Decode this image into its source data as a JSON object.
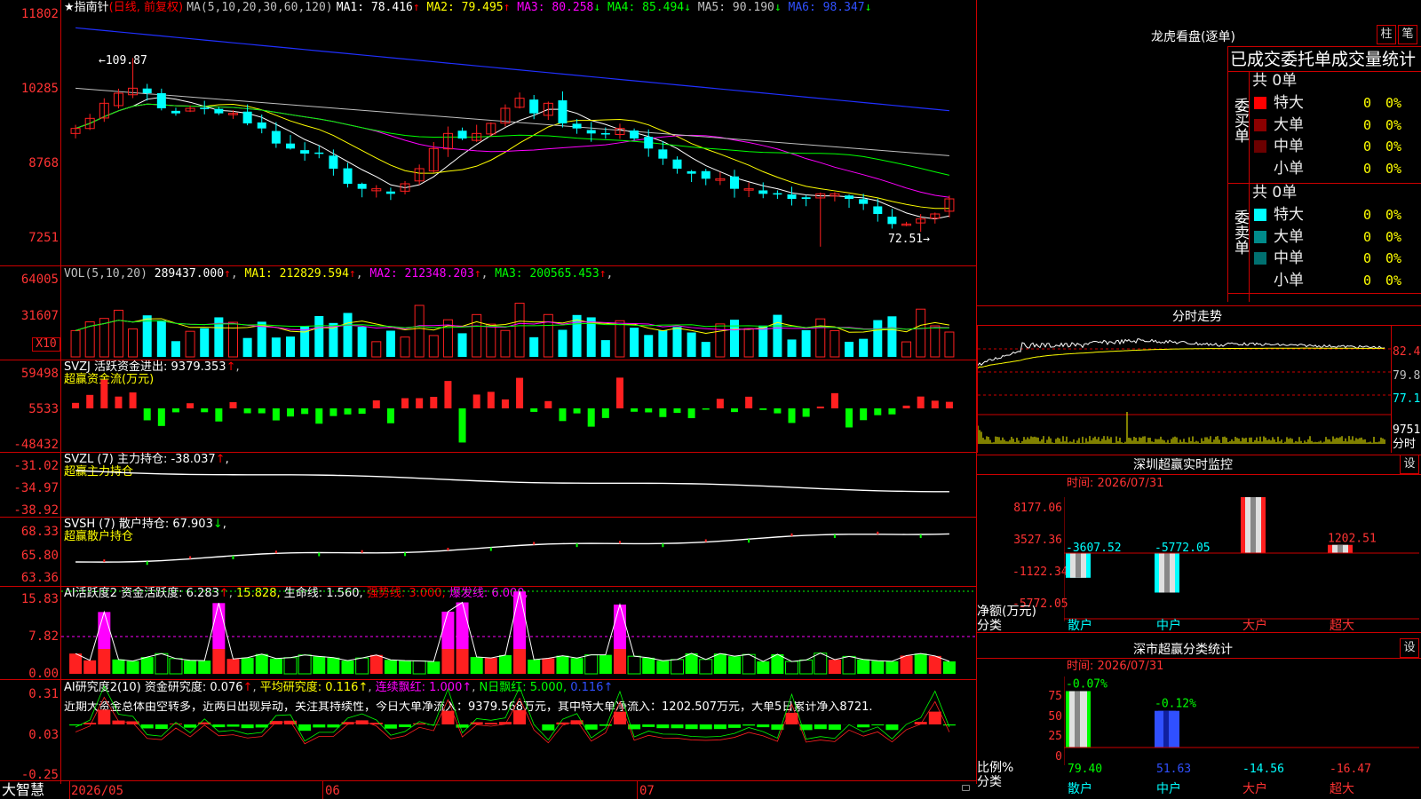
{
  "app": {
    "brand": "大智慧"
  },
  "kline": {
    "star": "★",
    "name": "指南针",
    "period": "(日线, 前复权)",
    "ma_params": "MA(5,10,20,30,60,120)",
    "ma": [
      {
        "label": "MA1:",
        "value": "78.416",
        "arrow": "↑",
        "color": "#ffffff"
      },
      {
        "label": "MA2:",
        "value": "79.495",
        "arrow": "↑",
        "color": "#ffff00"
      },
      {
        "label": "MA3:",
        "value": "80.258",
        "arrow": "↓",
        "color": "#ff00ff"
      },
      {
        "label": "MA4:",
        "value": "85.494",
        "arrow": "↓",
        "color": "#00ff00"
      },
      {
        "label": "MA5:",
        "value": "90.190",
        "arrow": "↓",
        "color": "#c0c0c0"
      },
      {
        "label": "MA6:",
        "value": "98.347",
        "arrow": "↓",
        "color": "#3050ff"
      }
    ],
    "y_labels": [
      "11802",
      "10285",
      "8768",
      "7251"
    ],
    "high_label": "←109.87",
    "low_label": "72.51→"
  },
  "vol": {
    "label": "VOL(5,10,20)",
    "value": "289437.000",
    "arrow": "↑",
    "ma": [
      {
        "text": "MA1: 212829.594",
        "arrow": "↑",
        "color": "#ffff00"
      },
      {
        "text": "MA2: 212348.203",
        "arrow": "↑",
        "color": "#ff00ff"
      },
      {
        "text": "MA3: 200565.453",
        "arrow": "↑",
        "color": "#00ff00"
      }
    ],
    "y_labels": [
      "64005",
      "31607"
    ],
    "unit": "X10"
  },
  "svzj": {
    "title": "SVZJ  活跃资金进出: 9379.353",
    "arrow": "↑",
    "sub": "超赢资金流(万元)",
    "y_labels": [
      "59498",
      "5533",
      "-48432"
    ]
  },
  "svzl": {
    "title": "SVZL (7) 主力持仓: -38.037",
    "arrow": "↑",
    "tail": ",",
    "sub": "超赢主力持仓",
    "y_labels": [
      "-31.02",
      "-34.97",
      "-38.92"
    ]
  },
  "svsh": {
    "title": "SVSH (7) 散户持仓: 67.903",
    "arrow": "↓",
    "tail": ",",
    "sub": "超赢散户持仓",
    "y_labels": [
      "68.33",
      "65.80",
      "63.36"
    ]
  },
  "ai1": {
    "title": "AI活跃度2 资金活跃度: 6.283",
    "arrow1": "↑",
    "v2": "15.828,",
    "life": "生命线: 1.560,",
    "strong": "强势线: 3.000,",
    "burst": "爆发线: 6.000,",
    "y_labels": [
      "15.83",
      "7.82",
      "0.00"
    ]
  },
  "ai2": {
    "title": "AI研究度2(10) 资金研究度: 0.076",
    "arrow": "↑",
    "avg": "平均研究度: 0.116↑",
    "red": "连续飘红: 1.000↑",
    "n": "N日飘红: 5.000,",
    "last": "0.116↑",
    "comment": "近期大资金总体由空转多，近两日出现异动，关注其持续性，今日大单净流入：9379.568万元，其中特大单净流入：1202.507万元，大单5日累计净入8721.",
    "y_labels": [
      "0.31",
      "0.03",
      "-0.25"
    ]
  },
  "xaxis": {
    "labels": [
      "2026/05",
      "06",
      "07"
    ]
  },
  "lhb": {
    "title": "龙虎看盘(逐单)",
    "btn_bar": "柱",
    "btn_pen": "笔",
    "header": "已成交委托单成交量统计",
    "buy": {
      "side": "委买单",
      "count": "共 0单",
      "rows": [
        {
          "label": "特大",
          "v": "0",
          "p": "0%",
          "color": "#ff0000"
        },
        {
          "label": "大单",
          "v": "0",
          "p": "0%",
          "color": "#8b0000"
        },
        {
          "label": "中单",
          "v": "0",
          "p": "0%",
          "color": "#6b0000"
        },
        {
          "label": "小单",
          "v": "0",
          "p": "0%",
          "color": ""
        }
      ]
    },
    "sell": {
      "side": "委卖单",
      "count": "共 0单",
      "rows": [
        {
          "label": "特大",
          "v": "0",
          "p": "0%",
          "color": "#00ffff"
        },
        {
          "label": "大单",
          "v": "0",
          "p": "0%",
          "color": "#008b8b"
        },
        {
          "label": "中单",
          "v": "0",
          "p": "0%",
          "color": "#007070"
        },
        {
          "label": "小单",
          "v": "0",
          "p": "0%",
          "color": ""
        }
      ]
    }
  },
  "fenshi": {
    "title": "分时走势",
    "labels": [
      "82.49",
      "79.80",
      "77.11"
    ],
    "vol_label": "9751",
    "vol_unit": "分时"
  },
  "sz_monitor": {
    "title": "深圳超赢实时监控",
    "btn": "设",
    "time": "时间: 2026/07/31",
    "y_labels": [
      "8177.06",
      "3527.36",
      "-1122.34",
      "-5772.05"
    ],
    "unit": "净额(万元)",
    "cat_title": "分类",
    "categories": [
      "散户",
      "中户",
      "大户",
      "超大"
    ],
    "values": [
      "-3607.52",
      "-5772.05",
      "8177.06",
      "1202.51"
    ]
  },
  "sz_class": {
    "title": "深市超赢分类统计",
    "btn": "设",
    "time": "时间: 2026/07/31",
    "y_labels": [
      "75",
      "50",
      "25",
      "0"
    ],
    "unit": "比例%",
    "cat_title": "分类",
    "categories": [
      "散户",
      "中户",
      "大户",
      "超大"
    ],
    "top_labels": [
      "-0.07%",
      "-0.12%"
    ],
    "values": [
      "79.40",
      "51.63",
      "-14.56",
      "-16.47"
    ]
  }
}
